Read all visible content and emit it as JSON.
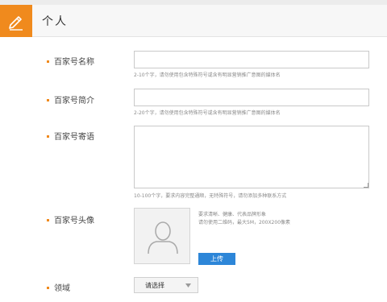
{
  "header": {
    "title": "个人",
    "icon": "pencil-icon",
    "accent": "#f08a1d"
  },
  "form": {
    "name": {
      "label": "百家号名称",
      "value": "",
      "hint": "2-10个字，请勿使用包含特殊符号或含有明显营销推广意图的媒体名"
    },
    "intro": {
      "label": "百家号简介",
      "value": "",
      "hint": "2-20个字，请勿使用包含特殊符号或含有明显营销推广意图的媒体名"
    },
    "motto": {
      "label": "百家号寄语",
      "value": "",
      "hint": "10-100个字，要求内容完整通顺，无特殊符号，请勿添加多种联系方式"
    },
    "avatar": {
      "label": "百家号头像",
      "req_line1": "要求清晰、健康、代表品牌形象",
      "req_line2": "请勿使用二维码，最大5M，200X200像素",
      "upload_label": "上传",
      "button_color": "#2d86d8"
    },
    "domain": {
      "label": "领域",
      "selected": "请选择"
    }
  }
}
